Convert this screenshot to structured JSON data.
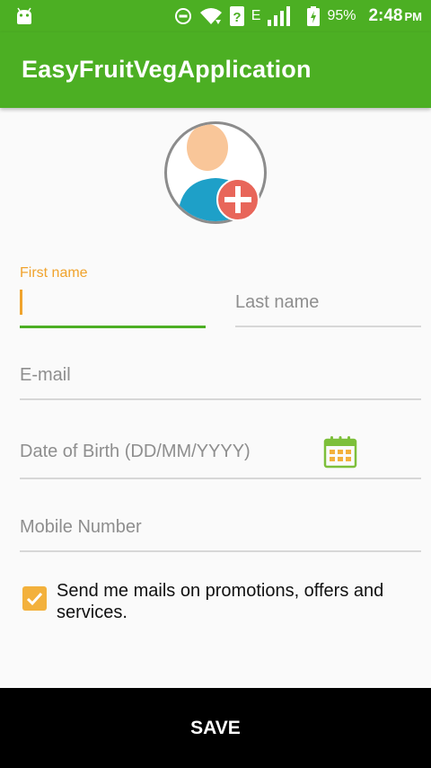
{
  "status_bar": {
    "battery": "95%",
    "time": "2:48",
    "ampm": "PM",
    "network_label": "E"
  },
  "app_bar": {
    "title": "EasyFruitVegApplication"
  },
  "form": {
    "first_name": {
      "label": "First name",
      "value": ""
    },
    "last_name": {
      "placeholder": "Last name"
    },
    "email": {
      "placeholder": "E-mail"
    },
    "dob": {
      "placeholder": "Date of Birth (DD/MM/YYYY)"
    },
    "mobile": {
      "placeholder": "Mobile Number"
    },
    "promo_checkbox": {
      "checked": true,
      "label": "Send me mails on promotions, offers and services."
    }
  },
  "footer": {
    "save_label": "SAVE"
  },
  "colors": {
    "primary": "#4caf23",
    "accent": "#f0a32d",
    "avatar_badge": "#e8665a"
  },
  "icons": [
    "android-icon",
    "dnd-icon",
    "wifi-icon",
    "signal-icon",
    "battery-icon",
    "user-avatar-icon",
    "add-photo-icon",
    "calendar-icon",
    "checkbox-checked-icon"
  ]
}
